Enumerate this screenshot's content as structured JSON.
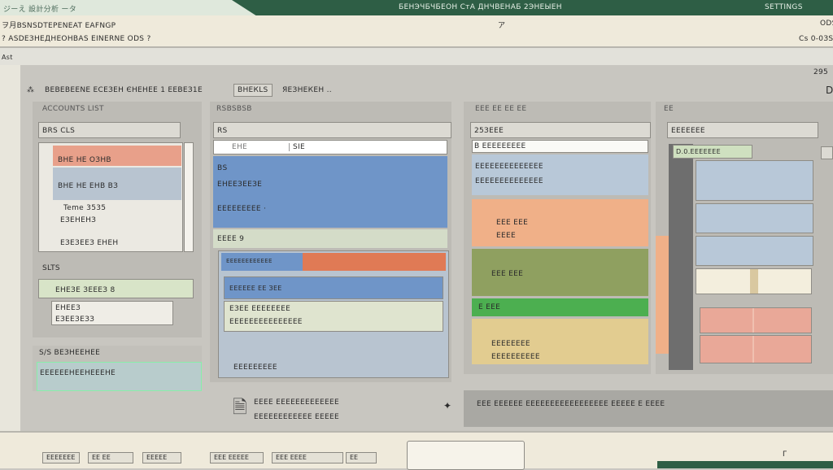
{
  "titlebar": {
    "left_text": "ジーえ 設計分析 ータ",
    "center_text": "БЕНЭЧБЧБЕОН СтА ДНЧВЕНАБ 2ЭНЕЫЕН",
    "right_text": "SETTINGS"
  },
  "menu": {
    "line1": "ヲ月BSNSDTEPENEAT EAFNGP",
    "line1_mid": "ア",
    "line1_right": "ODS",
    "line2": "? ASDEЗНЕДНЕОНВАЅ EINERNE ODS ?",
    "line2_right": "Cs 0-0ЗS"
  },
  "toolbar": {
    "label": "Ast",
    "right": "295"
  },
  "main": {
    "header_text": "BEBEBEENЕ ЕСЕЗЕН ЄНЕНЕЕ 1 EEBEЗ1Е",
    "header_button": "ВНЕКLS",
    "header_after": "ЯЕЗНЕКЕН ..",
    "right_icon": "D"
  },
  "left": {
    "title": "ACCOUNTS LIST",
    "box": "BRS CLS",
    "rows": [
      "ВНЕ НЕ ОЗНВ",
      "ВНЕ НЕ ЕНВ ВЗ",
      "Teme 3535"
    ],
    "extra": [
      "EЗЕНЕНЗ",
      "ЕЗЕЗЕЕЗ ЕНЕН"
    ],
    "section": "SLTS",
    "green": "ЕНЕЗЕ ЗЕЕЕЗ 8",
    "white": [
      "ЕНЕЕЗ",
      "ЕЗЕЕЗЕЗЗ"
    ],
    "bottom_title": "S/S ВЕЗНЕЕНЕЕ",
    "bottom_text": "ЕЕЕЕЕЕНЕЕНЕЕЕНЕ"
  },
  "middle": {
    "title": "RSBSBSB",
    "box": "RS",
    "input": "ЕНЕ",
    "input_right": "SIE",
    "blue": [
      "ВS",
      "ЕНЕЕЗЕЕЗЕ",
      "ЕЕЕЕЕЕЕЕЕ ·"
    ],
    "green": "ЕЕЕЕ 9",
    "orange": "ЕЕЕЕЕЕЕЕЕЕЕЕ",
    "blue2": "ЕЕЕЕЕЕ ЕЕ ЗЕЕ",
    "light": [
      "ЕЗЕЕ ЕЕЕЕЕЕЕЕ",
      "ЕЕЕЕЕЕЕЕЕЕЕЕЕЕЕ"
    ],
    "lower": "ЕЕЕЕЕЕЕЕЕ",
    "footer": [
      "ЕЕЕЕ ЕЕЕЕЕЕЕЕЕЕЕЕЕ",
      "ЕЕЕЕЕЕЕЕЕЕЕЕ ЕЕЕЕЕ"
    ]
  },
  "right1": {
    "title": "ЕЕЕ ЕЕ ЕЕ ЕЕ",
    "box": "25ЗЕЕЕ",
    "white": "B ЕЕЕЕЕЕЕЕЕ",
    "blue": [
      "ЕЕЕЕЕЕЕЕЕЕЕЕЕЕ",
      "ЕЕЕЕЕЕЕЕЕЕЕЕЕЕ"
    ],
    "orange": [
      "ЕЕЕ ЕЕЕ",
      "ЕЕЕЕ"
    ],
    "olive": "ЕЕЕ ЕЕЕ",
    "green": "Е ЕЕЕ",
    "tan": [
      "ЕЕЕЕЕЕЕЕ",
      "ЕЕЕЕЕЕЕЕЕЕ"
    ]
  },
  "right2": {
    "title": "ЕЕ",
    "box": "ЕЕЕЕЕЕЕ",
    "label": "D.0.ЕЕЕЕЕЕЕ"
  },
  "bottom_bar": "ЕЕЕ ЕЕЕЕЕЕ ЕЕЕЕЕЕЕЕЕЕЕЕЕЕЕЕЕ ЕЕЕЕЕ Е ЕЕЕЕ",
  "footer": {
    "buttons": [
      "ЕЕЕЕЕЕЕ",
      "ЕЕ ЕЕ",
      "ЕЕЕЕЕ",
      "ЕЕЕ ЕЕЕЕЕ",
      "ЕЕЕ ЕЕЕЕ",
      "ЕЕ"
    ],
    "right": "Г"
  }
}
